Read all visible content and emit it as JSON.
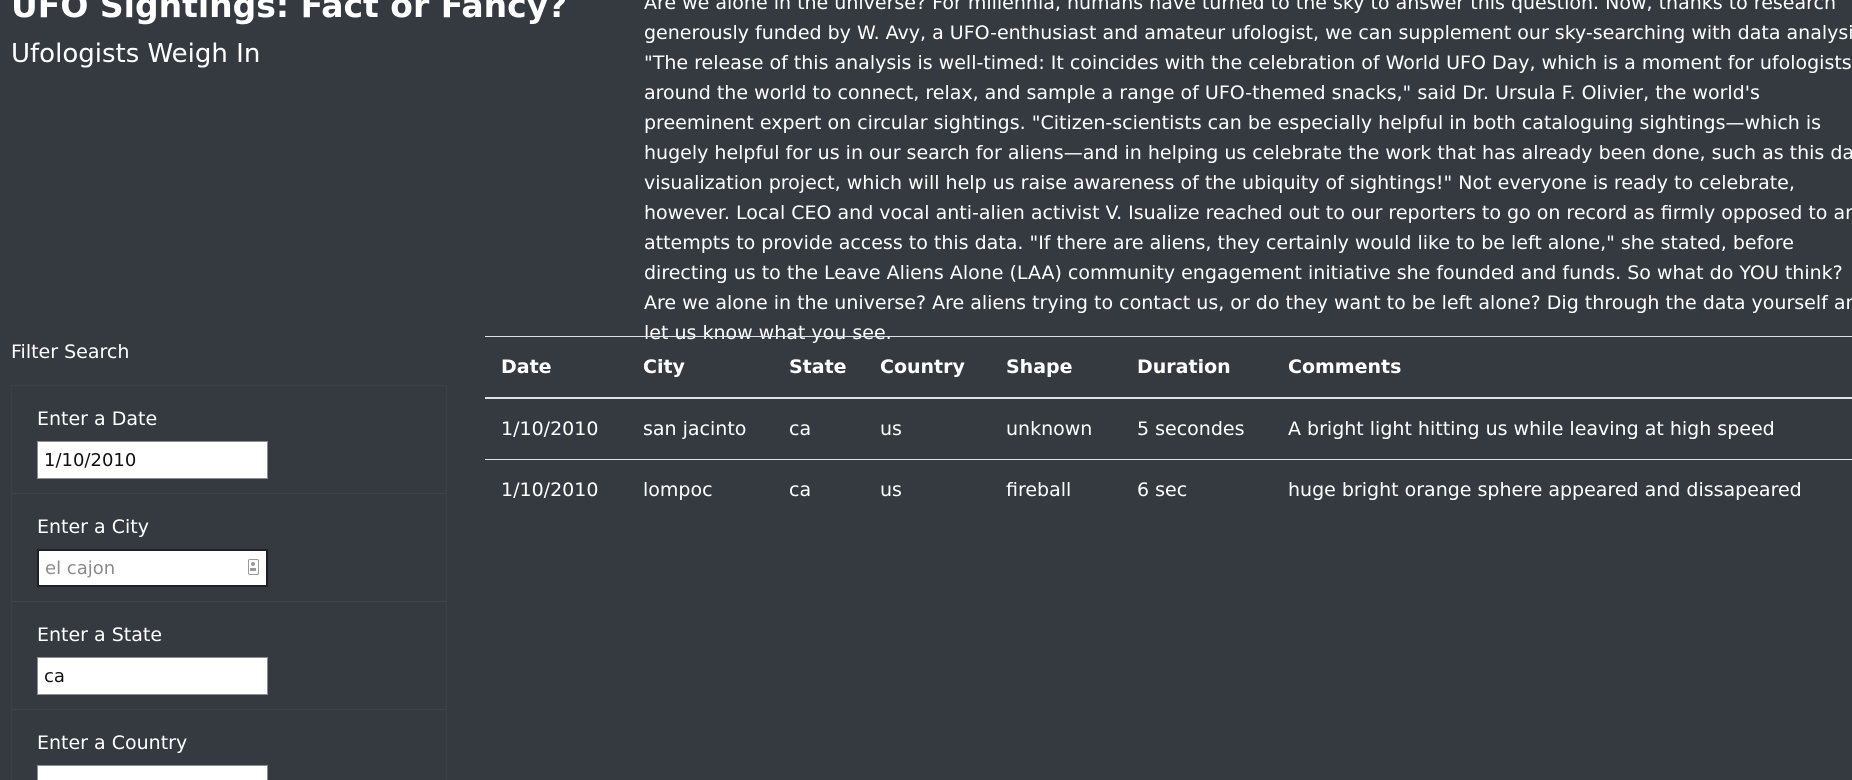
{
  "header": {
    "title": "UFO Sightings: Fact or Fancy?",
    "subtitle": "Ufologists Weigh In"
  },
  "article": {
    "text": "Are we alone in the universe? For millennia, humans have turned to the sky to answer this question. Now, thanks to research generously funded by W. Avy, a UFO-enthusiast and amateur ufologist, we can supplement our sky-searching with data analysis. \"The release of this analysis is well-timed: It coincides with the celebration of World UFO Day, which is a moment for ufologists around the world to connect, relax, and sample a range of UFO-themed snacks,\" said Dr. Ursula F. Olivier, the world's preeminent expert on circular sightings. \"Citizen-scientists can be especially helpful in both cataloguing sightings—which is hugely helpful for us in our search for aliens—and in helping us celebrate the work that has already been done, such as this data visualization project, which will help us raise awareness of the ubiquity of sightings!\" Not everyone is ready to celebrate, however. Local CEO and vocal anti-alien activist V. Isualize reached out to our reporters to go on record as firmly opposed to any attempts to provide access to this data. \"If there are aliens, they certainly would like to be left alone,\" she stated, before directing us to the Leave Aliens Alone (LAA) community engagement initiative she founded and funds. So what do YOU think? Are we alone in the universe? Are aliens trying to contact us, or do they want to be left alone? Dig through the data yourself and let us know what you see."
  },
  "filters": {
    "heading": "Filter Search",
    "date": {
      "label": "Enter a Date",
      "value": "1/10/2010",
      "placeholder": ""
    },
    "city": {
      "label": "Enter a City",
      "value": "",
      "placeholder": "el cajon",
      "icon": "contact-card-icon"
    },
    "state": {
      "label": "Enter a State",
      "value": "ca",
      "placeholder": ""
    },
    "country": {
      "label": "Enter a Country",
      "value": "",
      "placeholder": ""
    }
  },
  "table": {
    "headers": [
      "Date",
      "City",
      "State",
      "Country",
      "Shape",
      "Duration",
      "Comments"
    ],
    "rows": [
      [
        "1/10/2010",
        "san jacinto",
        "ca",
        "us",
        "unknown",
        "5 secondes",
        "A bright light hitting us while leaving at high speed"
      ],
      [
        "1/10/2010",
        "lompoc",
        "ca",
        "us",
        "fireball",
        "6 sec",
        "huge bright orange sphere appeared and dissapeared"
      ]
    ]
  },
  "colors": {
    "background": "#353a41",
    "text": "#ffffff",
    "table_rule": "#dee2e6"
  }
}
